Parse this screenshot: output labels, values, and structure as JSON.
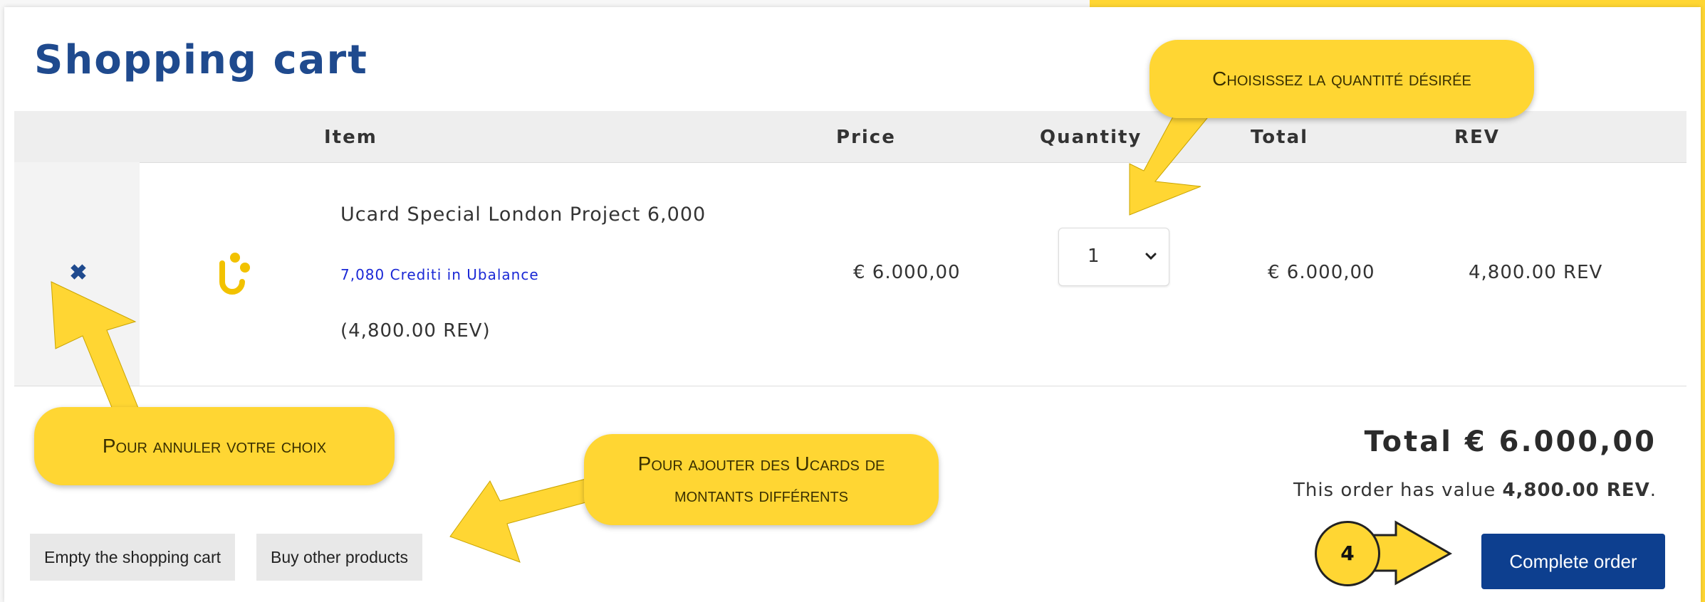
{
  "page": {
    "title": "Shopping cart"
  },
  "table": {
    "headers": {
      "item": "Item",
      "price": "Price",
      "quantity": "Quantity",
      "total": "Total",
      "rev": "REV"
    },
    "rows": [
      {
        "name": "Ucard Special London Project 6,000",
        "link": "7,080 Crediti in Ubalance",
        "rev_note": "(4,800.00 REV)",
        "price": "€ 6.000,00",
        "quantity": "1",
        "total": "€ 6.000,00",
        "rev": "4,800.00 REV"
      }
    ]
  },
  "summary": {
    "total_label": "Total  € 6.000,00",
    "order_value_prefix": "This order has value ",
    "order_value_amount": "4,800.00 REV",
    "order_value_suffix": "."
  },
  "buttons": {
    "empty_cart": "Empty the shopping cart",
    "buy_other": "Buy other products",
    "complete_order": "Complete order"
  },
  "callouts": {
    "quantity": "Choisissez la quantité désirée",
    "cancel": "Pour annuler votre choix",
    "add_line1": "Pour ajouter des Ucards de",
    "add_line2": "montants différents",
    "step_number": "4"
  },
  "colors": {
    "title": "#1f4a8e",
    "callout_yellow": "#ffd633",
    "primary_button": "#0d3f8f",
    "link": "#1a28d6"
  }
}
